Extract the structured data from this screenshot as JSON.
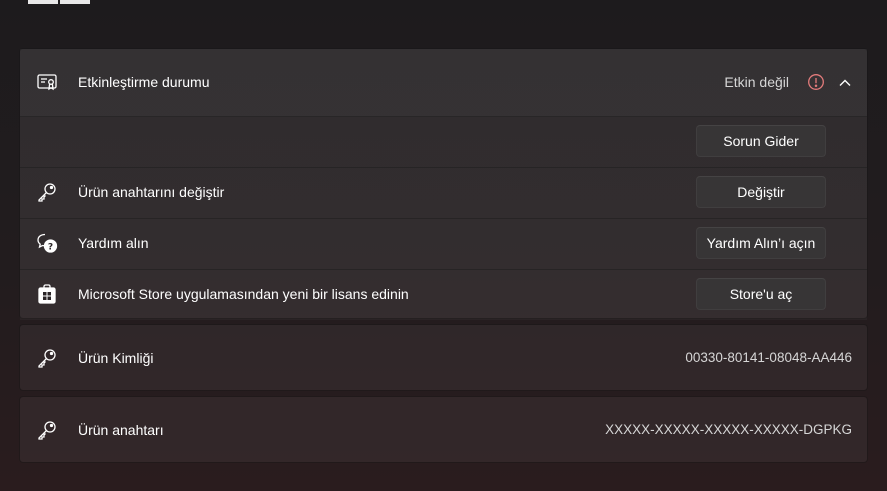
{
  "activation": {
    "title": "Etkinleştirme durumu",
    "status": "Etkin değil",
    "accent_error": "#e27b7b",
    "rows": [
      {
        "label": "",
        "button": "Sorun Gider",
        "icon": "none"
      },
      {
        "label": "Ürün anahtarını değiştir",
        "button": "Değiştir",
        "icon": "key-icon"
      },
      {
        "label": "Yardım alın",
        "button": "Yardım Alın’ı açın",
        "icon": "help-chat-icon"
      },
      {
        "label": "Microsoft Store uygulamasından yeni bir lisans edinin",
        "button": "Store'u aç",
        "icon": "store-icon"
      }
    ]
  },
  "product_id": {
    "label": "Ürün Kimliği",
    "value": "00330-80141-08048-AA446",
    "icon": "key-icon"
  },
  "product_key": {
    "label": "Ürün anahtarı",
    "value": "XXXXX-XXXXX-XXXXX-XXXXX-DGPKG",
    "icon": "key-icon"
  }
}
